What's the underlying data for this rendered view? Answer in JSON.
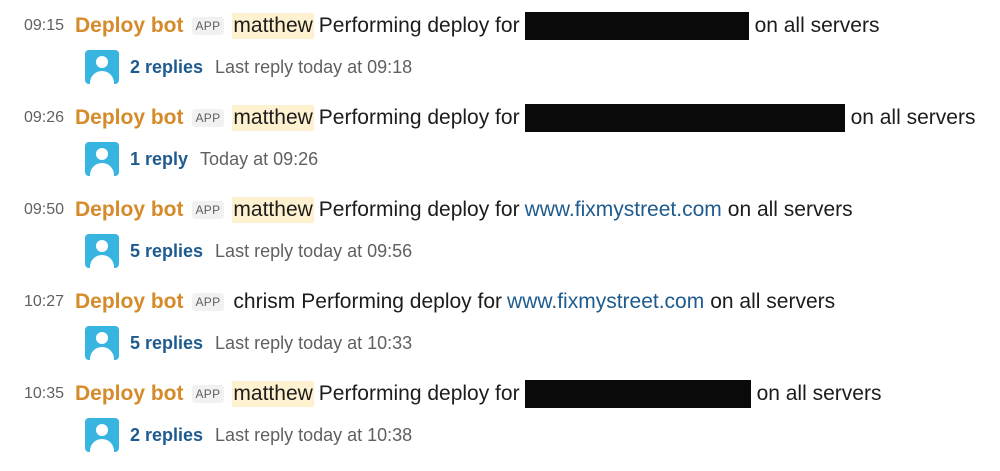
{
  "bot_name": "Deploy bot",
  "app_badge": "APP",
  "colors": {
    "bot_name": "#d58b2a",
    "link": "#1e5b8e",
    "mention_highlight": "#fdf1cf",
    "avatar": "#38b4e0",
    "redaction": "#0a0a0a"
  },
  "messages": [
    {
      "time": "09:15",
      "user": "matthew",
      "user_highlighted": true,
      "prefix": "Performing deploy for",
      "target": null,
      "target_redacted": true,
      "suffix": "on all servers",
      "replies": "2 replies",
      "last_reply": "Last reply today at 09:18",
      "avatar_icon": "user-avatar-icon"
    },
    {
      "time": "09:26",
      "user": "matthew",
      "user_highlighted": true,
      "prefix": "Performing deploy for",
      "target": null,
      "target_redacted": true,
      "suffix": "on all servers",
      "replies": "1 reply",
      "last_reply": "Today at 09:26",
      "avatar_icon": "user-avatar-icon"
    },
    {
      "time": "09:50",
      "user": "matthew",
      "user_highlighted": true,
      "prefix": "Performing deploy for",
      "target": "www.fixmystreet.com",
      "target_redacted": false,
      "suffix": "on all servers",
      "replies": "5 replies",
      "last_reply": "Last reply today at 09:56",
      "avatar_icon": "user-avatar-icon"
    },
    {
      "time": "10:27",
      "user": "chrism",
      "user_highlighted": false,
      "prefix": "Performing deploy for",
      "target": "www.fixmystreet.com",
      "target_redacted": false,
      "suffix": "on all servers",
      "replies": "5 replies",
      "last_reply": "Last reply today at 10:33",
      "avatar_icon": "user-avatar-icon"
    },
    {
      "time": "10:35",
      "user": "matthew",
      "user_highlighted": true,
      "prefix": "Performing deploy for",
      "target": null,
      "target_redacted": true,
      "suffix": "on all servers",
      "replies": "2 replies",
      "last_reply": "Last reply today at 10:38",
      "avatar_icon": "user-avatar-icon"
    }
  ]
}
